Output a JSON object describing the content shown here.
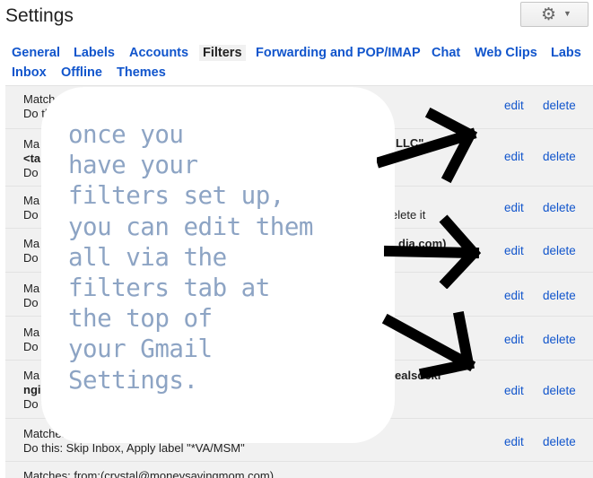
{
  "header": {
    "title": "Settings"
  },
  "tabs": [
    "General",
    "Labels",
    "Accounts",
    "Filters",
    "Forwarding and POP/IMAP",
    "Chat",
    "Web Clips",
    "Labs",
    "Inbox",
    "Offline",
    "Themes"
  ],
  "active_tab": "Filters",
  "filters": [
    {
      "line1": "Matches:",
      "line1_right": "",
      "line2": "Do thi",
      "line3": "",
      "edit": "edit",
      "delete": "delete"
    },
    {
      "line1": "Ma",
      "line1_right": "LLC\"",
      "line2": "<ta",
      "line3": "Do",
      "edit": "edit",
      "delete": "delete"
    },
    {
      "line1": "Ma",
      "line1_right": "elete it",
      "line2": "Do",
      "line3": "",
      "edit": "edit",
      "delete": "delete"
    },
    {
      "line1": "Ma",
      "line1_right": "dia.com)",
      "line2": "Do",
      "line3": "",
      "edit": "edit",
      "delete": "delete"
    },
    {
      "line1": "Ma",
      "line1_right": "",
      "line2": "Do",
      "line3": "",
      "edit": "edit",
      "delete": "delete"
    },
    {
      "line1": "Ma",
      "line1_right": "",
      "line2": "Do",
      "line3": "",
      "edit": "edit",
      "delete": "delete"
    },
    {
      "line1": "Ma",
      "line1_right": "ealsocki",
      "line2": "ngi",
      "line3": "Do t",
      "edit": "edit",
      "delete": "delete"
    },
    {
      "line1": "Matches: ",
      "line1_right": "",
      "line2": "Do this: Skip Inbox, Apply label \"*VA/MSM\"",
      "line3": "",
      "edit": "edit",
      "delete": "delete"
    },
    {
      "line1": "Matches: from:(crystal@moneysavingmom.com)",
      "line1_right": "",
      "line2": "",
      "line3": "",
      "edit": "",
      "delete": ""
    }
  ],
  "note": {
    "lines": [
      "once you",
      "have your",
      "filters set up,",
      "you can edit them",
      "all via the",
      "filters tab at",
      "the top of",
      "your Gmail",
      "Settings."
    ],
    "color": "#8da4c4"
  },
  "colors": {
    "link": "#1155cc",
    "list_bg": "#f1f1f1",
    "arrow": "#000000"
  },
  "icons": {
    "settings": "gear-icon",
    "dropdown": "chevron-down-icon"
  }
}
